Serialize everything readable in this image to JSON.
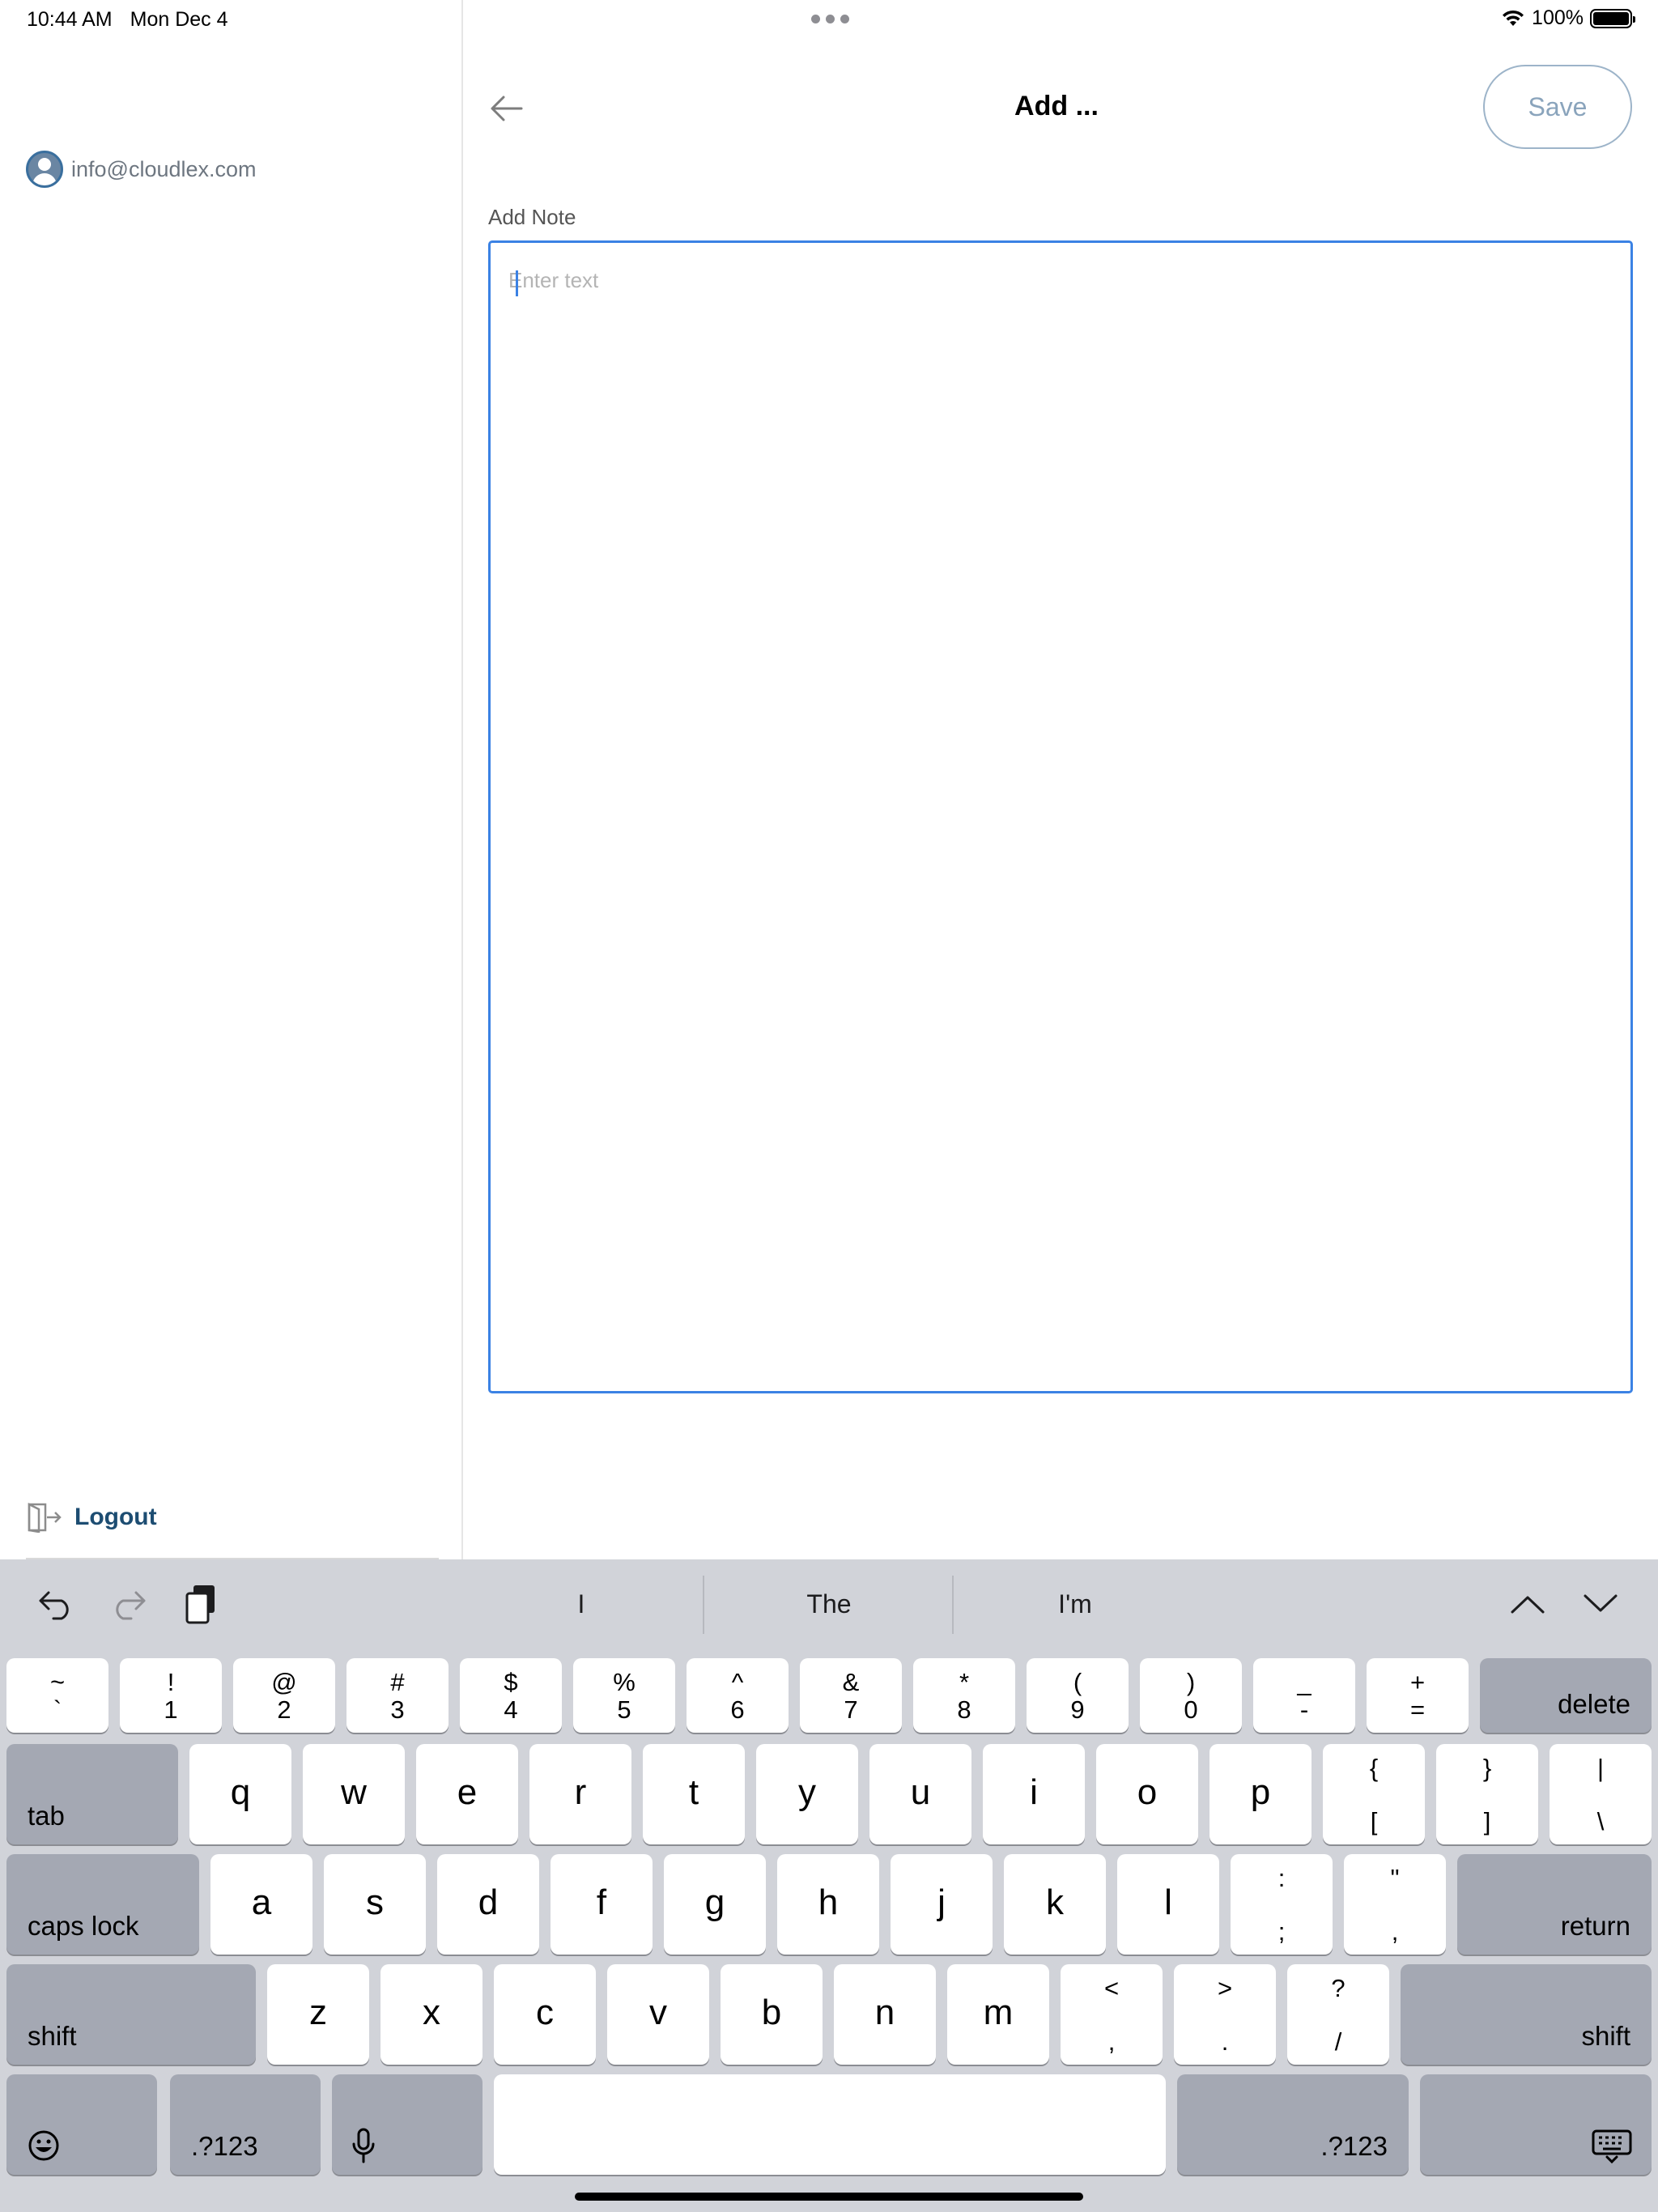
{
  "status_bar": {
    "time": "10:44 AM",
    "date": "Mon Dec 4",
    "battery": "100%"
  },
  "sidebar": {
    "user_email": "info@cloudlex.com",
    "logout_label": "Logout"
  },
  "header": {
    "title": "Add ...",
    "save_label": "Save"
  },
  "note": {
    "label": "Add Note",
    "placeholder": "Enter text",
    "value": ""
  },
  "keyboard": {
    "suggestions": [
      "I",
      "The",
      "I'm"
    ],
    "number_row": [
      {
        "top": "~",
        "bottom": "`"
      },
      {
        "top": "!",
        "bottom": "1"
      },
      {
        "top": "@",
        "bottom": "2"
      },
      {
        "top": "#",
        "bottom": "3"
      },
      {
        "top": "$",
        "bottom": "4"
      },
      {
        "top": "%",
        "bottom": "5"
      },
      {
        "top": "^",
        "bottom": "6"
      },
      {
        "top": "&",
        "bottom": "7"
      },
      {
        "top": "*",
        "bottom": "8"
      },
      {
        "top": "(",
        "bottom": "9"
      },
      {
        "top": ")",
        "bottom": "0"
      },
      {
        "top": "_",
        "bottom": "-"
      },
      {
        "top": "+",
        "bottom": "="
      }
    ],
    "delete": "delete",
    "tab": "tab",
    "row_q": [
      "q",
      "w",
      "e",
      "r",
      "t",
      "y",
      "u",
      "i",
      "o",
      "p"
    ],
    "row_q_symbols": [
      {
        "top": "{",
        "bottom": "["
      },
      {
        "top": "}",
        "bottom": "]"
      },
      {
        "top": "|",
        "bottom": "\\"
      }
    ],
    "caps_lock": "caps lock",
    "row_a": [
      "a",
      "s",
      "d",
      "f",
      "g",
      "h",
      "j",
      "k",
      "l"
    ],
    "row_a_symbols": [
      {
        "top": ":",
        "bottom": ";"
      },
      {
        "top": "\"",
        "bottom": ","
      }
    ],
    "return": "return",
    "shift": "shift",
    "row_z": [
      "z",
      "x",
      "c",
      "v",
      "b",
      "n",
      "m"
    ],
    "row_z_symbols": [
      {
        "top": "<",
        "bottom": ","
      },
      {
        "top": ">",
        "bottom": "."
      },
      {
        "top": "?",
        "bottom": "/"
      }
    ],
    "numbers_label": ".?123"
  },
  "icons": {
    "back": "arrow-left-icon",
    "avatar": "user-avatar-icon",
    "logout": "logout-door-icon",
    "undo": "undo-icon",
    "redo": "redo-icon",
    "paste": "clipboard-icon",
    "up": "chevron-up-icon",
    "down": "chevron-down-icon",
    "emoji": "emoji-icon",
    "mic": "microphone-icon",
    "dismiss": "keyboard-dismiss-icon"
  },
  "colors": {
    "accent": "#3b82e4",
    "logout": "#1d4d72",
    "save_border": "#9db4c9",
    "keyboard_bg": "#d1d3d9"
  }
}
